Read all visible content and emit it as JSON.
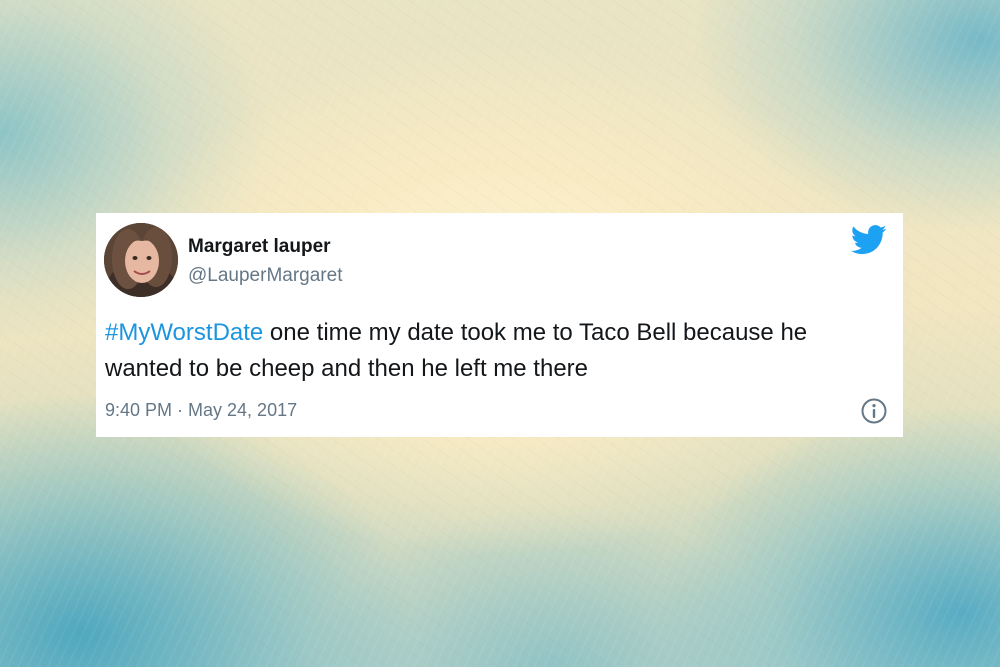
{
  "tweet": {
    "author_name": "Margaret lauper",
    "author_handle": "@LauperMargaret",
    "hashtag": "#MyWorstDate",
    "body": " one time my date took me to Taco Bell because he wanted to be cheep and then he left me there",
    "timestamp": "9:40 PM · May 24, 2017"
  },
  "icons": {
    "brand": "twitter-bird-icon",
    "info": "info-icon"
  },
  "colors": {
    "hashtag": "#1b95e0",
    "twitter_blue": "#1da1f2",
    "secondary_text": "#657786",
    "primary_text": "#14171a"
  }
}
